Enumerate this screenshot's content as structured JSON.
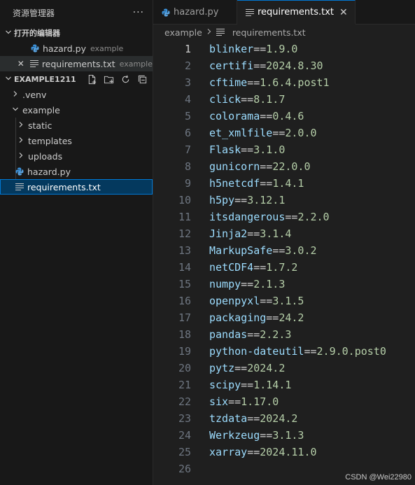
{
  "sidebar": {
    "title": "资源管理器",
    "more": "···",
    "open_editors": {
      "header": "打开的编辑器",
      "items": [
        {
          "name": "hazard.py",
          "desc": "example"
        },
        {
          "name": "requirements.txt",
          "desc": "example"
        }
      ]
    },
    "workspace": {
      "header": "EXAMPLE1211",
      "tree": [
        {
          "name": ".venv"
        },
        {
          "name": "example"
        },
        {
          "name": "static"
        },
        {
          "name": "templates"
        },
        {
          "name": "uploads"
        },
        {
          "name": "hazard.py"
        },
        {
          "name": "requirements.txt"
        }
      ]
    }
  },
  "tabs": [
    {
      "label": "hazard.py"
    },
    {
      "label": "requirements.txt"
    }
  ],
  "breadcrumb": {
    "folder": "example",
    "file": "requirements.txt"
  },
  "editor": {
    "lines": [
      {
        "n": "1",
        "pkg": "blinker",
        "op": "==",
        "ver": "1.9.0"
      },
      {
        "n": "2",
        "pkg": "certifi",
        "op": "==",
        "ver": "2024.8.30"
      },
      {
        "n": "3",
        "pkg": "cftime",
        "op": "==",
        "ver": "1.6.4.post1"
      },
      {
        "n": "4",
        "pkg": "click",
        "op": "==",
        "ver": "8.1.7"
      },
      {
        "n": "5",
        "pkg": "colorama",
        "op": "==",
        "ver": "0.4.6"
      },
      {
        "n": "6",
        "pkg": "et_xmlfile",
        "op": "==",
        "ver": "2.0.0"
      },
      {
        "n": "7",
        "pkg": "Flask",
        "op": "==",
        "ver": "3.1.0"
      },
      {
        "n": "8",
        "pkg": "gunicorn",
        "op": "==",
        "ver": "22.0.0"
      },
      {
        "n": "9",
        "pkg": "h5netcdf",
        "op": "==",
        "ver": "1.4.1"
      },
      {
        "n": "10",
        "pkg": "h5py",
        "op": "==",
        "ver": "3.12.1"
      },
      {
        "n": "11",
        "pkg": "itsdangerous",
        "op": "==",
        "ver": "2.2.0"
      },
      {
        "n": "12",
        "pkg": "Jinja2",
        "op": "==",
        "ver": "3.1.4"
      },
      {
        "n": "13",
        "pkg": "MarkupSafe",
        "op": "==",
        "ver": "3.0.2"
      },
      {
        "n": "14",
        "pkg": "netCDF4",
        "op": "==",
        "ver": "1.7.2"
      },
      {
        "n": "15",
        "pkg": "numpy",
        "op": "==",
        "ver": "2.1.3"
      },
      {
        "n": "16",
        "pkg": "openpyxl",
        "op": "==",
        "ver": "3.1.5"
      },
      {
        "n": "17",
        "pkg": "packaging",
        "op": "==",
        "ver": "24.2"
      },
      {
        "n": "18",
        "pkg": "pandas",
        "op": "==",
        "ver": "2.2.3"
      },
      {
        "n": "19",
        "pkg": "python-dateutil",
        "op": "==",
        "ver": "2.9.0.post0"
      },
      {
        "n": "20",
        "pkg": "pytz",
        "op": "==",
        "ver": "2024.2"
      },
      {
        "n": "21",
        "pkg": "scipy",
        "op": "==",
        "ver": "1.14.1"
      },
      {
        "n": "22",
        "pkg": "six",
        "op": "==",
        "ver": "1.17.0"
      },
      {
        "n": "23",
        "pkg": "tzdata",
        "op": "==",
        "ver": "2024.2"
      },
      {
        "n": "24",
        "pkg": "Werkzeug",
        "op": "==",
        "ver": "3.1.3"
      },
      {
        "n": "25",
        "pkg": "xarray",
        "op": "==",
        "ver": "2024.11.0"
      },
      {
        "n": "26",
        "pkg": "",
        "op": "",
        "ver": ""
      }
    ]
  },
  "watermark": "CSDN @Wei22980",
  "colors": {
    "accent": "#0078d4",
    "selection": "#04395e",
    "package": "#9cdcfe",
    "version": "#b5cea8",
    "python_icon": "#3b8fd6"
  }
}
